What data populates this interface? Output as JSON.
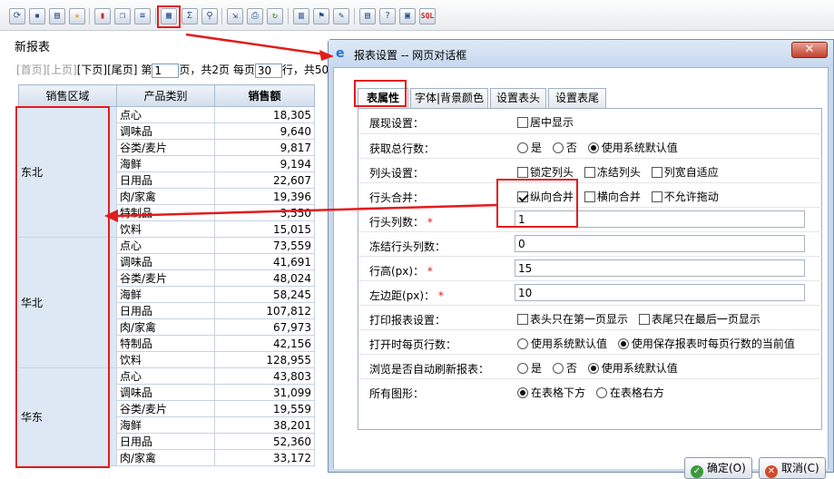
{
  "toolbar": {
    "icons": [
      "refresh-icon",
      "save-icon",
      "export-icon",
      "favorite-icon",
      "chart-icon",
      "copy-icon",
      "sort-icon",
      "report-settings-icon",
      "sum-icon",
      "query-icon",
      "insert-icon",
      "print-icon",
      "reload-icon",
      "layout-icon",
      "filter-icon",
      "format-icon",
      "table-icon",
      "help-icon",
      "image-icon",
      "sql-icon"
    ],
    "sql_label": "SQL"
  },
  "report": {
    "title": "新报表",
    "pager": {
      "first": "[首页]",
      "prev": "[上页]",
      "next": "[下页]",
      "last": "[尾页]",
      "page_prefix": "第",
      "page_value": "1",
      "page_suffix": "页，共2页",
      "per_page_prefix": "每页",
      "per_page_value": "30",
      "per_page_suffix": "行，共50"
    },
    "headers": [
      "销售区域",
      "产品类别",
      "销售额"
    ],
    "groups": [
      {
        "region": "东北",
        "rows": [
          [
            "点心",
            "18,305"
          ],
          [
            "调味品",
            "9,640"
          ],
          [
            "谷类/麦片",
            "9,817"
          ],
          [
            "海鲜",
            "9,194"
          ],
          [
            "日用品",
            "22,607"
          ],
          [
            "肉/家禽",
            "19,396"
          ],
          [
            "特制品",
            "3,550"
          ],
          [
            "饮料",
            "15,015"
          ]
        ]
      },
      {
        "region": "华北",
        "rows": [
          [
            "点心",
            "73,559"
          ],
          [
            "调味品",
            "41,691"
          ],
          [
            "谷类/麦片",
            "48,024"
          ],
          [
            "海鲜",
            "58,245"
          ],
          [
            "日用品",
            "107,812"
          ],
          [
            "肉/家禽",
            "67,973"
          ],
          [
            "特制品",
            "42,156"
          ],
          [
            "饮料",
            "128,955"
          ]
        ]
      },
      {
        "region": "华东",
        "rows": [
          [
            "点心",
            "43,803"
          ],
          [
            "调味品",
            "31,099"
          ],
          [
            "谷类/麦片",
            "19,559"
          ],
          [
            "海鲜",
            "38,201"
          ],
          [
            "日用品",
            "52,360"
          ],
          [
            "肉/家禽",
            "33,172"
          ]
        ]
      }
    ]
  },
  "dialog": {
    "title": "报表设置 -- 网页对话框",
    "close": "✕",
    "tabs": [
      "表属性",
      "字体|背景颜色",
      "设置表头",
      "设置表尾"
    ],
    "active_tab": 0,
    "rows": {
      "display": {
        "label": "展现设置：",
        "option": "居中显示"
      },
      "total_rows": {
        "label": "获取总行数：",
        "options": [
          "是",
          "否",
          "使用系统默认值"
        ]
      },
      "column_head": {
        "label": "列头设置：",
        "options": [
          "锁定列头",
          "冻结列头",
          "列宽自适应"
        ]
      },
      "row_merge": {
        "label": "行头合并：",
        "options": [
          "纵向合并",
          "横向合并",
          "不允许拖动"
        ]
      },
      "row_head_cols": {
        "label": "行头列数：",
        "required": "*",
        "value": "1"
      },
      "frozen_cols": {
        "label": "冻结行头列数：",
        "value": "0"
      },
      "row_height": {
        "label": "行高(px)：",
        "required": "*",
        "value": "15"
      },
      "left_margin": {
        "label": "左边距(px)：",
        "required": "*",
        "value": "10"
      },
      "print_setting": {
        "label": "打印报表设置：",
        "options": [
          "表头只在第一页显示",
          "表尾只在最后一页显示"
        ]
      },
      "page_rows": {
        "label": "打开时每页行数：",
        "options": [
          "使用系统默认值",
          "使用保存报表时每页行数的当前值"
        ]
      },
      "auto_refresh": {
        "label": "浏览是否自动刷新报表：",
        "options": [
          "是",
          "否",
          "使用系统默认值"
        ]
      },
      "graphics": {
        "label": "所有图形：",
        "options": [
          "在表格下方",
          "在表格右方"
        ]
      }
    },
    "ok": "确定(O)",
    "cancel": "取消(C)"
  },
  "colors": {
    "highlight": "#e31b1b",
    "accent": "#2b6cc4"
  }
}
